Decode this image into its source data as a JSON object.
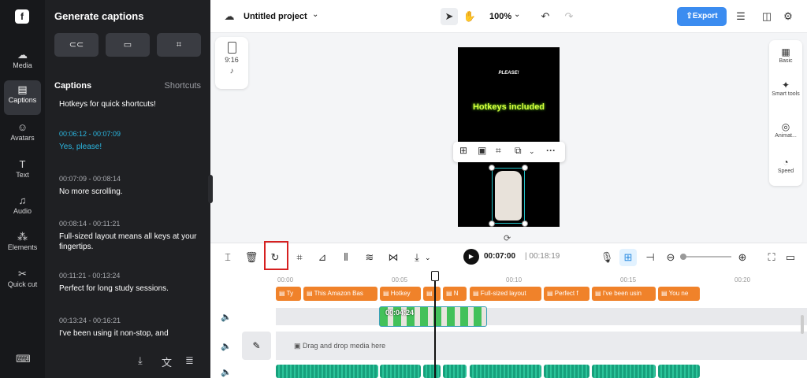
{
  "nav": {
    "items": [
      {
        "label": "Media",
        "icon": "cloud-icon"
      },
      {
        "label": "Captions",
        "icon": "captions-icon"
      },
      {
        "label": "Avatars",
        "icon": "avatar-icon"
      },
      {
        "label": "Text",
        "icon": "text-icon"
      },
      {
        "label": "Audio",
        "icon": "music-icon"
      },
      {
        "label": "Elements",
        "icon": "elements-icon"
      },
      {
        "label": "Quick cut",
        "icon": "quick-cut-icon"
      }
    ],
    "active": "Captions"
  },
  "panel": {
    "title": "Generate captions",
    "captions_heading": "Captions",
    "shortcuts_label": "Shortcuts",
    "partial_top": "Hotkeys for quick shortcuts!",
    "entries": [
      {
        "time": "00:06:12 - 00:07:09",
        "text": "Yes, please!",
        "active": true
      },
      {
        "time": "00:07:09 - 00:08:14",
        "text": "No more scrolling."
      },
      {
        "time": "00:08:14 - 00:11:21",
        "text": "Full-sized layout means all keys at your fingertips."
      },
      {
        "time": "00:11:21 - 00:13:24",
        "text": "Perfect for long study sessions."
      },
      {
        "time": "00:13:24 - 00:16:21",
        "text": "I've been using it non-stop, and"
      }
    ]
  },
  "topbar": {
    "project_name": "Untitled project",
    "zoom": "100%",
    "export_label": "Export"
  },
  "canvas": {
    "ratio": "9:16",
    "video_text_top": "PLEASE!",
    "video_text_main": "Hotkeys included"
  },
  "right_panel": [
    "Basic",
    "Smart tools",
    "Animat...",
    "Speed"
  ],
  "player": {
    "current_time": "00:07:00",
    "total_time": "00:18:19"
  },
  "timeline": {
    "ruler": [
      "00:00",
      "00:05",
      "00:10",
      "00:15",
      "00:20"
    ],
    "caption_clips": [
      "Ty",
      "This Amazon Bas",
      "Hotkey",
      "",
      "N",
      "Full-sized layout",
      "Perfect f",
      "I've been usin",
      "You ne"
    ],
    "video_clip_time": "00:04:24",
    "drop_text": "Drag and drop media here"
  },
  "colors": {
    "accent": "#3b8cf0",
    "caption_clip": "#f0822a",
    "active_caption": "#2bb6e0",
    "highlight_box": "#d62020"
  }
}
